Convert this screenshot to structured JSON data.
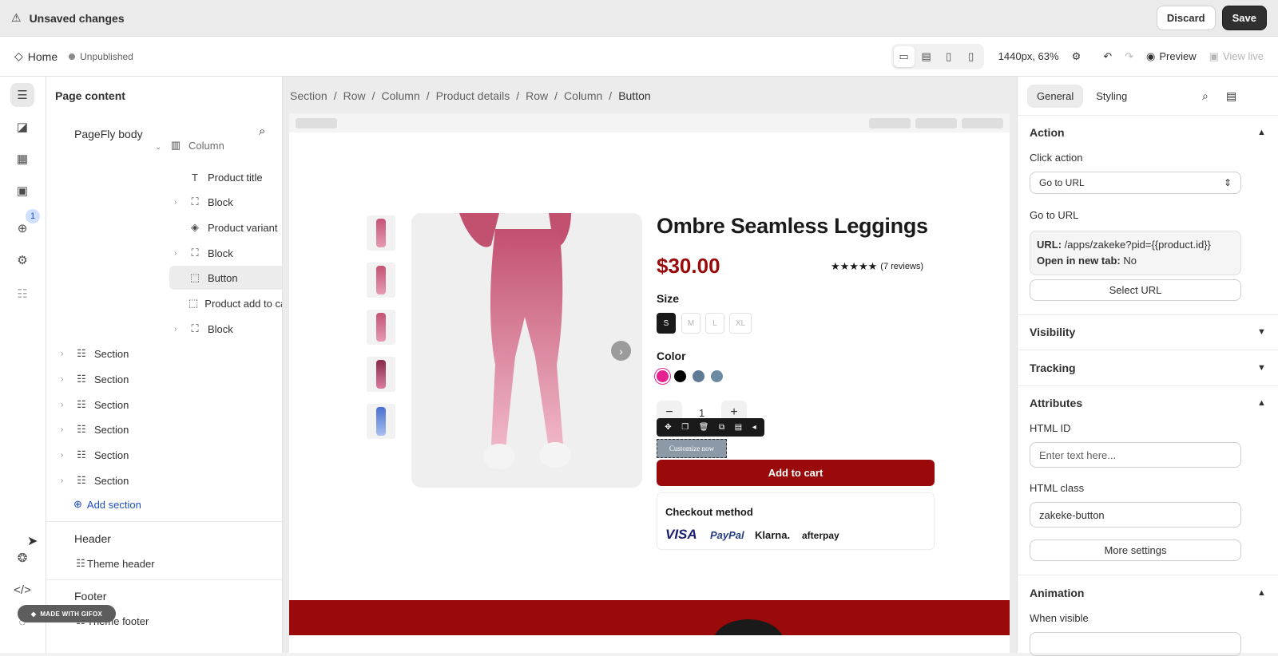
{
  "topbar": {
    "warning_icon": "warning-icon",
    "title": "Unsaved changes",
    "discard_label": "Discard",
    "save_label": "Save"
  },
  "toolbar": {
    "page_name": "Home",
    "status": "Unpublished",
    "viewport": "1440px, 63%",
    "preview_label": "Preview",
    "view_live_label": "View live"
  },
  "rail": {
    "badge_count": "1"
  },
  "left_panel": {
    "title": "Page content",
    "subtitle": "PageFly body",
    "truncated_row": "Column",
    "tree": [
      {
        "label": "Product title",
        "icon": "text-icon"
      },
      {
        "label": "Block",
        "icon": "block-icon"
      },
      {
        "label": "Product variant",
        "icon": "variant-icon"
      },
      {
        "label": "Block",
        "icon": "block-icon"
      },
      {
        "label": "Button",
        "icon": "cursor-icon"
      },
      {
        "label": "Product add to cart",
        "icon": "cursor-icon"
      },
      {
        "label": "Block",
        "icon": "block-icon"
      }
    ],
    "sections": [
      "Section",
      "Section",
      "Section",
      "Section",
      "Section",
      "Section"
    ],
    "add_section": "Add section",
    "header_title": "Header",
    "header_item": "Theme header",
    "footer_title": "Footer",
    "footer_item": "Theme footer"
  },
  "breadcrumb": [
    "Section",
    "Row",
    "Column",
    "Product details",
    "Row",
    "Column",
    "Button"
  ],
  "breadcrumb_sep": "/",
  "product": {
    "title": "Ombre Seamless Leggings",
    "price": "$30.00",
    "stars": "★★★★★",
    "reviews": "(7 reviews)",
    "size_label": "Size",
    "sizes": [
      "S",
      "M",
      "L",
      "XL"
    ],
    "color_label": "Color",
    "colors": [
      "#e5218f",
      "#000000",
      "#5f7a94",
      "#6d8aa3"
    ],
    "qty_minus": "−",
    "qty_plus": "+",
    "qty": "1",
    "customize_label": "Customize now",
    "add_to_cart": "Add to cart",
    "checkout_label": "Checkout method",
    "payment_methods": [
      "VISA",
      "PayPal",
      "Klarna.",
      "afterpay"
    ]
  },
  "right_panel": {
    "tabs": [
      "General",
      "Styling"
    ],
    "action_title": "Action",
    "click_action_label": "Click action",
    "click_action_value": "Go to URL",
    "go_to_url_label": "Go to URL",
    "url_key": "URL:",
    "url_value": "/apps/zakeke?pid={{product.id}}",
    "new_tab_key": "Open in new tab:",
    "new_tab_value": "No",
    "select_url": "Select URL",
    "visibility_title": "Visibility",
    "tracking_title": "Tracking",
    "attributes_title": "Attributes",
    "html_id_label": "HTML ID",
    "html_id_placeholder": "Enter text here...",
    "html_class_label": "HTML class",
    "html_class_value": "zakeke-button",
    "more_settings": "More settings",
    "animation_title": "Animation",
    "when_visible_label": "When visible"
  },
  "watermark": "MADE WITH GIFOX"
}
